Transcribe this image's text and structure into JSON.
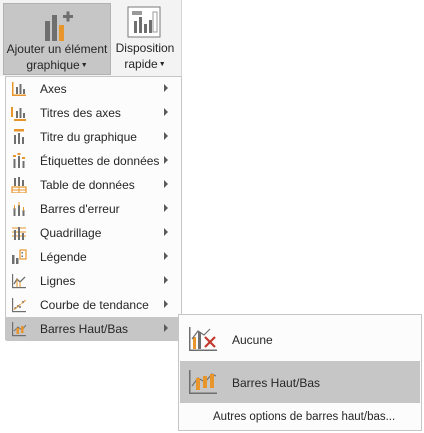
{
  "ribbon": {
    "add_element_label_line1": "Ajouter un élément",
    "add_element_label_line2": "graphique",
    "quick_layout_label_line1": "Disposition",
    "quick_layout_label_line2": "rapide"
  },
  "menu": {
    "items": [
      {
        "label": "Axes"
      },
      {
        "label": "Titres des axes"
      },
      {
        "label": "Titre du graphique"
      },
      {
        "label": "Étiquettes de données"
      },
      {
        "label": "Table de données"
      },
      {
        "label": "Barres d'erreur"
      },
      {
        "label": "Quadrillage"
      },
      {
        "label": "Légende"
      },
      {
        "label": "Lignes"
      },
      {
        "label": "Courbe de tendance"
      },
      {
        "label": "Barres Haut/Bas"
      }
    ]
  },
  "submenu": {
    "none_label": "Aucune",
    "updown_label": "Barres Haut/Bas",
    "more_label": "Autres options de barres haut/bas..."
  },
  "colors": {
    "accent_orange": "#e8962c",
    "icon_gray": "#6f6f6f",
    "hover_bg": "#c6c6c6",
    "removal_red": "#c0392b"
  }
}
